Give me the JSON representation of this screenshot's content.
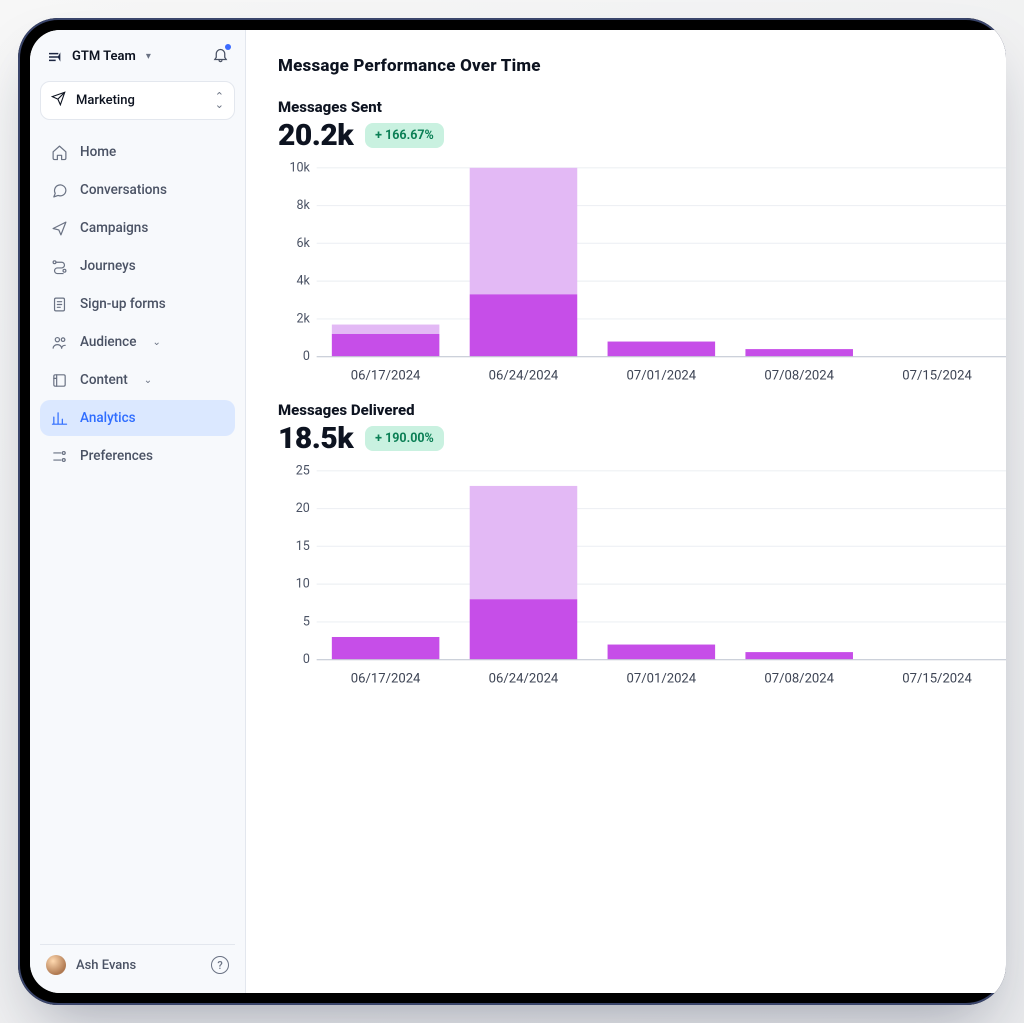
{
  "team": {
    "name": "GTM Team"
  },
  "workspace_picker": {
    "label": "Marketing"
  },
  "nav": {
    "items": [
      {
        "label": "Home",
        "icon": "home",
        "expandable": false
      },
      {
        "label": "Conversations",
        "icon": "chat",
        "expandable": false
      },
      {
        "label": "Campaigns",
        "icon": "send",
        "expandable": false
      },
      {
        "label": "Journeys",
        "icon": "journey",
        "expandable": false
      },
      {
        "label": "Sign-up forms",
        "icon": "form",
        "expandable": false
      },
      {
        "label": "Audience",
        "icon": "audience",
        "expandable": true
      },
      {
        "label": "Content",
        "icon": "content",
        "expandable": true
      },
      {
        "label": "Analytics",
        "icon": "analytics",
        "expandable": false,
        "active": true
      },
      {
        "label": "Preferences",
        "icon": "preferences",
        "expandable": false
      }
    ]
  },
  "user": {
    "name": "Ash Evans"
  },
  "page": {
    "title": "Message Performance Over Time"
  },
  "metrics": {
    "sent": {
      "title": "Messages Sent",
      "value": "20.2k",
      "delta": "+ 166.67%"
    },
    "delivered": {
      "title": "Messages Delivered",
      "value": "18.5k",
      "delta": "+ 190.00%"
    }
  },
  "chart_data": [
    {
      "type": "bar",
      "title": "Messages Sent",
      "ylabel": "",
      "ylim": [
        0,
        10000
      ],
      "yticks": [
        0,
        2000,
        4000,
        6000,
        8000,
        10000
      ],
      "ytick_labels": [
        "0",
        "2k",
        "4k",
        "6k",
        "8k",
        "10k"
      ],
      "categories": [
        "06/17/2024",
        "06/24/2024",
        "07/01/2024",
        "07/08/2024",
        "07/15/2024"
      ],
      "series": [
        {
          "name": "primary",
          "color": "#c64ee8",
          "values": [
            1200,
            3300,
            800,
            400,
            0
          ]
        },
        {
          "name": "secondary",
          "color": "#e3b9f5",
          "values": [
            500,
            6700,
            0,
            0,
            0
          ]
        }
      ]
    },
    {
      "type": "bar",
      "title": "Messages Delivered",
      "ylabel": "",
      "ylim": [
        0,
        25
      ],
      "yticks": [
        0,
        5,
        10,
        15,
        20,
        25
      ],
      "ytick_labels": [
        "0",
        "5",
        "10",
        "15",
        "20",
        "25"
      ],
      "categories": [
        "06/17/2024",
        "06/24/2024",
        "07/01/2024",
        "07/08/2024",
        "07/15/2024"
      ],
      "series": [
        {
          "name": "primary",
          "color": "#c64ee8",
          "values": [
            3,
            8,
            2,
            1,
            0
          ]
        },
        {
          "name": "secondary",
          "color": "#e3b9f5",
          "values": [
            0,
            15,
            0,
            0,
            0
          ]
        }
      ]
    }
  ]
}
